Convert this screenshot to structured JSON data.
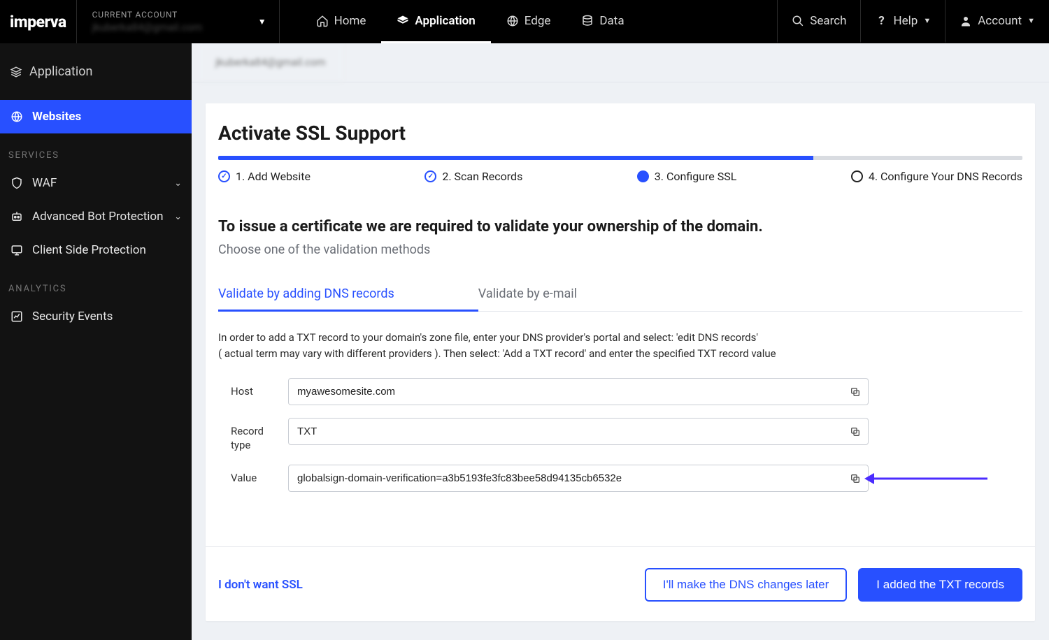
{
  "brand": "imperva",
  "currentAccount": {
    "label": "CURRENT ACCOUNT",
    "value": "jkuberka84@gmail.com"
  },
  "topnav": {
    "home": "Home",
    "application": "Application",
    "edge": "Edge",
    "data": "Data",
    "search": "Search",
    "help": "Help",
    "account": "Account"
  },
  "sidebar": {
    "top": "Application",
    "websites": "Websites",
    "servicesLabel": "SERVICES",
    "waf": "WAF",
    "abp": "Advanced Bot Protection",
    "csp": "Client Side Protection",
    "analyticsLabel": "ANALYTICS",
    "securityEvents": "Security Events"
  },
  "breadcrumb": "jkuberka84@gmail.com",
  "page": {
    "title": "Activate SSL Support",
    "steps": {
      "s1": "1. Add Website",
      "s2": "2. Scan Records",
      "s3": "3. Configure SSL",
      "s4": "4. Configure Your DNS Records"
    },
    "heading": "To issue a certificate we are required to validate your ownership of the domain.",
    "sub": "Choose one of the validation methods",
    "tabs": {
      "dns": "Validate by adding DNS records",
      "email": "Validate by e-mail"
    },
    "help1": "In order to add a TXT record to your domain's zone file, enter your DNS provider's portal and select: 'edit DNS records'",
    "help2": "( actual term may vary with different providers ). Then select: 'Add a TXT record' and enter the specified TXT record value",
    "fields": {
      "hostLabel": "Host",
      "hostValue": "myawesomesite.com",
      "recordTypeLabel": "Record type",
      "recordTypeValue": "TXT",
      "valueLabel": "Value",
      "valueValue": "globalsign-domain-verification=a3b5193fe3fc83bee58d94135cb6532e"
    },
    "footer": {
      "noSsl": "I don't want SSL",
      "later": "I'll make the DNS changes later",
      "added": "I added the TXT records"
    }
  }
}
